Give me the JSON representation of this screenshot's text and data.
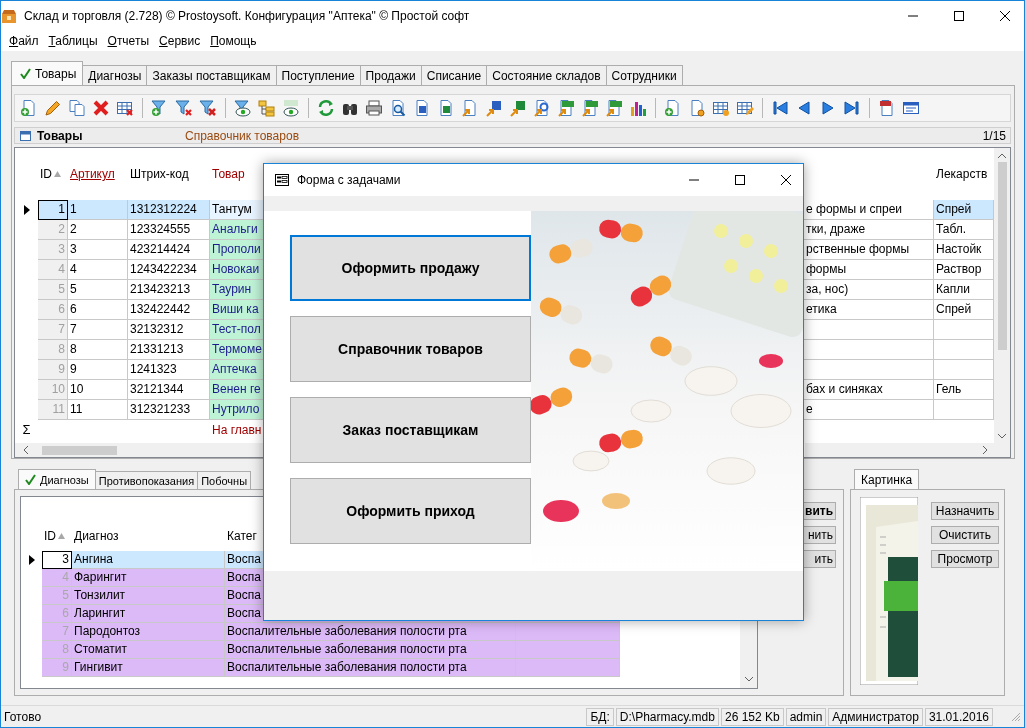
{
  "window": {
    "title": "Склад и торговля (2.728) © Prostoysoft. Конфигурация \"Аптека\" © Простой софт"
  },
  "menu": [
    "Файл",
    "Таблицы",
    "Отчеты",
    "Сервис",
    "Помощь"
  ],
  "tabs": [
    {
      "label": "Товары",
      "selected": true
    },
    {
      "label": "Диагнозы",
      "selected": false
    },
    {
      "label": "Заказы поставщикам",
      "selected": false
    },
    {
      "label": "Поступление",
      "selected": false
    },
    {
      "label": "Продажи",
      "selected": false
    },
    {
      "label": "Списание",
      "selected": false
    },
    {
      "label": "Состояние складов",
      "selected": false
    },
    {
      "label": "Сотрудники",
      "selected": false
    }
  ],
  "panel": {
    "title": "Товары",
    "subtitle": "Справочник товаров",
    "page": "1/15"
  },
  "grid": {
    "columns": [
      {
        "label": "ID",
        "sorted": true,
        "underlined": false,
        "color": "#000000"
      },
      {
        "label": "Артикул",
        "sorted": false,
        "underlined": true,
        "color": "#a00000"
      },
      {
        "label": "Штрих-код",
        "sorted": false,
        "underlined": false,
        "color": "#000000"
      },
      {
        "label": "Товар",
        "sorted": false,
        "underlined": false,
        "color": "#a00000"
      },
      {
        "label": "Лекарств",
        "sorted": false,
        "underlined": false,
        "color": "#000000"
      }
    ],
    "rows": [
      {
        "id": "1",
        "article": "1",
        "barcode": "1312312224",
        "product": "Тантум",
        "column_5": "е формы и спреи",
        "column_6": "Спрей",
        "selected": true
      },
      {
        "id": "2",
        "article": "2",
        "barcode": "123324555",
        "product": "Анальги",
        "column_5": "тки, драже",
        "column_6": "Табл.",
        "selected": false
      },
      {
        "id": "3",
        "article": "3",
        "barcode": "423214424",
        "product": "Прополи",
        "column_5": "рственные формы",
        "column_6": "Настойк",
        "selected": false
      },
      {
        "id": "4",
        "article": "4",
        "barcode": "1243422234",
        "product": "Новокаи",
        "column_5": "формы",
        "column_6": "Раствор",
        "selected": false
      },
      {
        "id": "5",
        "article": "5",
        "barcode": "213423213",
        "product": "Таурин",
        "column_5": "за, нос)",
        "column_6": "Капли",
        "selected": false
      },
      {
        "id": "6",
        "article": "6",
        "barcode": "132422442",
        "product": "Виши ка",
        "column_5": "етика",
        "column_6": "Спрей",
        "selected": false
      },
      {
        "id": "7",
        "article": "7",
        "barcode": "32132312",
        "product": "Тест-пол",
        "selected": false
      },
      {
        "id": "8",
        "article": "8",
        "barcode": "21331213",
        "product": "Термоме",
        "selected": false
      },
      {
        "id": "9",
        "article": "9",
        "barcode": "1241323",
        "product": "Аптечка",
        "selected": false
      },
      {
        "id": "10",
        "article": "10",
        "barcode": "32121344",
        "product": "Венен ге",
        "column_5": "бах и синяках",
        "column_6": "Гель",
        "selected": false
      },
      {
        "id": "11",
        "article": "11",
        "barcode": "312321233",
        "product": "Нутрило",
        "column_5": "е",
        "selected": false
      }
    ],
    "footer": {
      "marker": "Σ",
      "product": "На главн"
    }
  },
  "detail_tabs": [
    {
      "label": "Диагнозы",
      "selected": true
    },
    {
      "label": "Противопоказания",
      "selected": false
    },
    {
      "label": "Побочны",
      "selected": false
    }
  ],
  "detail_grid": {
    "columns": [
      {
        "label": "ID",
        "sorted": true
      },
      {
        "label": "Диагноз",
        "sorted": false
      },
      {
        "label": "Катег",
        "sorted": false
      }
    ],
    "rows": [
      {
        "id": "3",
        "diagnosis": "Ангина",
        "category": "Воспа",
        "selected": true
      },
      {
        "id": "4",
        "diagnosis": "Фарингит",
        "category": "Воспа",
        "selected": false
      },
      {
        "id": "5",
        "diagnosis": "Тонзилит",
        "category": "Воспа",
        "selected": false
      },
      {
        "id": "6",
        "diagnosis": "Ларингит",
        "category": "Воспа",
        "selected": false
      },
      {
        "id": "7",
        "diagnosis": "Пародонтоз",
        "category": "Воспалительные заболевания полости рта",
        "selected": false
      },
      {
        "id": "8",
        "diagnosis": "Стоматит",
        "category": "Воспалительные заболевания полости рта",
        "selected": false
      },
      {
        "id": "9",
        "diagnosis": "Гингивит",
        "category": "Воспалительные заболевания полости рта",
        "selected": false
      }
    ]
  },
  "detail_buttons": [
    {
      "label": "вить",
      "default": true
    },
    {
      "label": "нить",
      "default": false
    },
    {
      "label": "ить",
      "default": false
    }
  ],
  "picture_panel": {
    "tab": "Картинка",
    "buttons": [
      "Назначить",
      "Очистить",
      "Просмотр"
    ]
  },
  "status_bar": {
    "text": "Готово",
    "db_label": "БД:",
    "db_path": "D:\\Pharmacy.mdb",
    "size": "26 152 Kb",
    "user": "admin",
    "role": "Администратор",
    "date": "31.01.2016"
  },
  "dialog": {
    "title": "Форма с задачами",
    "buttons": [
      {
        "label": "Оформить продажу",
        "focused": true
      },
      {
        "label": "Справочник товаров",
        "focused": false
      },
      {
        "label": "Заказ поставщикам",
        "focused": false
      },
      {
        "label": "Оформить приход",
        "focused": false
      }
    ]
  }
}
